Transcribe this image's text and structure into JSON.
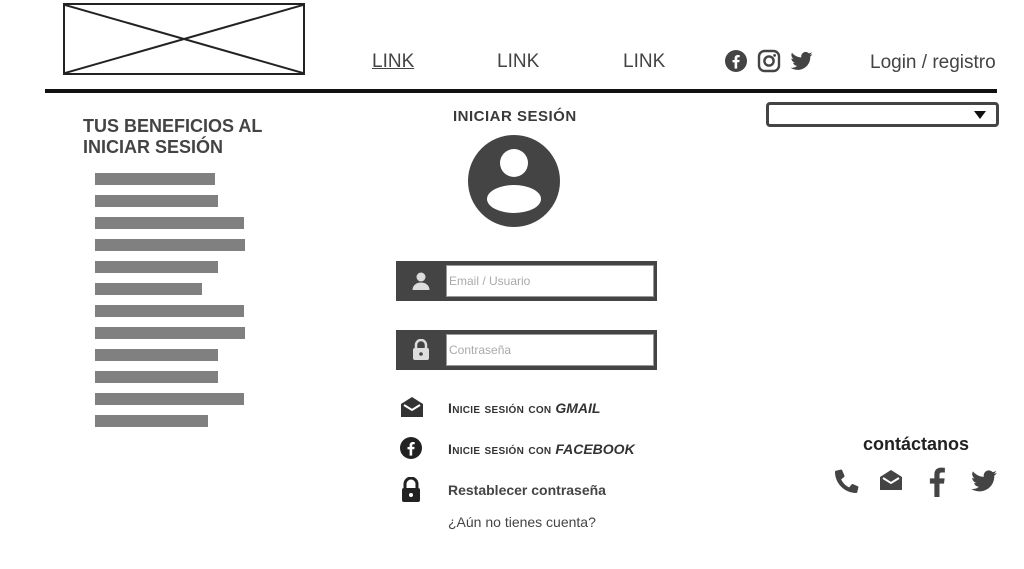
{
  "header": {
    "nav": [
      {
        "label": "LINK"
      },
      {
        "label": "LINK"
      },
      {
        "label": "LINK"
      }
    ],
    "social_icons": [
      "facebook-icon",
      "instagram-icon",
      "twitter-icon"
    ],
    "login_label": "Login / registro"
  },
  "benefits": {
    "title": "TUS BENEFICIOS AL INICIAR SESIÓN",
    "item_count": 12
  },
  "login": {
    "title": "INICIAR SESIÓN",
    "email_placeholder": "Email / Usuario",
    "password_placeholder": "Contraseña",
    "gmail_prefix": "Inicie sesión con",
    "gmail_brand": "GMAIL",
    "facebook_prefix": "Inicie sesión con",
    "facebook_brand": "FACEBOOK",
    "reset_label": "Restablecer contraseña",
    "signup_label": "¿Aún no tienes cuenta?"
  },
  "contact": {
    "title": "contáctanos",
    "icons": [
      "phone-icon",
      "envelope-icon",
      "facebook-icon",
      "twitter-icon"
    ]
  },
  "colors": {
    "dark": "#444444",
    "bar": "#808080",
    "rule": "#111111"
  }
}
